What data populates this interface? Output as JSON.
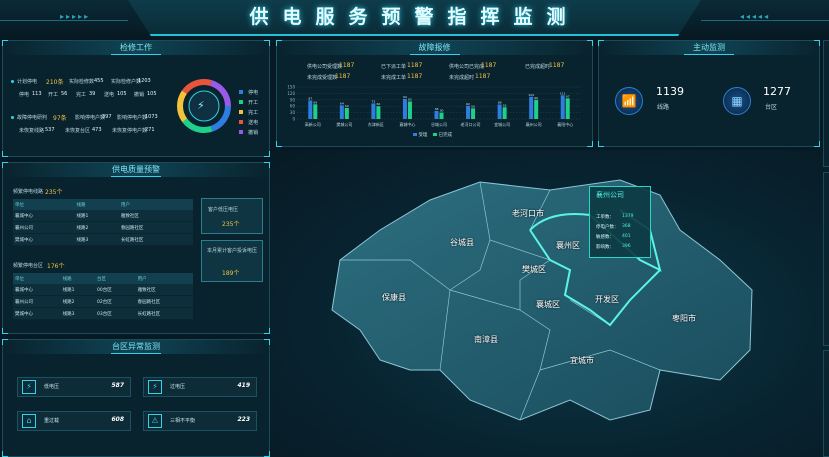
{
  "header": {
    "title": "供电服务预警指挥监测"
  },
  "repair": {
    "title": "检修工作",
    "planned": {
      "label": "计划停电",
      "count": "210条",
      "items": [
        {
          "label": "实际检修数",
          "value": "455"
        },
        {
          "label": "实际检修户数",
          "value": "1203"
        },
        {
          "label": "停电",
          "value": "113"
        },
        {
          "label": "开工",
          "value": "56"
        },
        {
          "label": "完工",
          "value": "39"
        },
        {
          "label": "送电",
          "value": "105"
        },
        {
          "label": "撤销",
          "value": "105"
        }
      ]
    },
    "fault": {
      "label": "故障停电研判",
      "count": "97条",
      "items": [
        {
          "label": "影响停电户数",
          "value": "397"
        },
        {
          "label": "影响停电户数",
          "value": "1073"
        },
        {
          "label": "未恢复线路",
          "value": "537"
        },
        {
          "label": "未恢复台区",
          "value": "473"
        },
        {
          "label": "未恢复停电户数",
          "value": "271"
        }
      ]
    },
    "legend": [
      "停电",
      "开工",
      "完工",
      "送电",
      "撤销"
    ],
    "ring_icon": "lightning-icon"
  },
  "quality": {
    "title": "供电质量预警",
    "low_voltage": {
      "label": "频繁停电线路",
      "count": "235个",
      "headers": [
        "单位",
        "线路",
        "用户"
      ],
      "rows": [
        [
          "襄城中心",
          "线路1",
          "雅致社区"
        ],
        [
          "襄州公司",
          "线路2",
          "春园路社区"
        ],
        [
          "樊城中心",
          "线路3",
          "长虹路社区"
        ]
      ]
    },
    "frequent": {
      "label": "频繁停电台区",
      "count": "176个",
      "headers": [
        "单位",
        "线路",
        "台区",
        "用户"
      ],
      "rows": [
        [
          "襄城中心",
          "线路1",
          "00台区",
          "雅致社区"
        ],
        [
          "襄州公司",
          "线路2",
          "02台区",
          "春园路社区"
        ],
        [
          "樊城中心",
          "线路3",
          "03台区",
          "长虹路社区"
        ]
      ]
    },
    "side_cards": [
      {
        "label": "客户低压电压",
        "value": "235个"
      },
      {
        "label": "本月累计客户投诉电压",
        "value": "189个"
      }
    ]
  },
  "station": {
    "title": "台区异常监测",
    "items": [
      {
        "icon": "voltage-low-icon",
        "glyph": "⚡",
        "label": "低电压",
        "value": "587"
      },
      {
        "icon": "voltage-high-icon",
        "glyph": "⚡",
        "label": "过电压",
        "value": "419"
      },
      {
        "icon": "overload-icon",
        "glyph": "⌂",
        "label": "重过载",
        "value": "608"
      },
      {
        "icon": "phase-imbalance-icon",
        "glyph": "⚠",
        "label": "三相不平衡",
        "value": "223"
      }
    ]
  },
  "fault_repair": {
    "title": "故障报修",
    "stats": [
      {
        "label": "供电公司受理数",
        "value": "1187"
      },
      {
        "label": "已下派工单",
        "value": "1187"
      },
      {
        "label": "供电公司已完成",
        "value": "1187"
      },
      {
        "label": "已完成超时",
        "value": "1187"
      },
      {
        "label": "未完成受理数",
        "value": "1187"
      },
      {
        "label": "未完成工单",
        "value": "1187"
      },
      {
        "label": "未完成超时",
        "value": "1187"
      }
    ],
    "legend": [
      "受理",
      "已完成"
    ],
    "colors": {
      "s1": "#2e7de0",
      "s2": "#1fd08a"
    }
  },
  "chart_data": {
    "type": "bar",
    "categories": [
      "高新公司",
      "樊城公司",
      "东津新区",
      "襄城中心",
      "谷城公司",
      "老河口公司",
      "宜城公司",
      "襄州公司",
      "襄阳中心"
    ],
    "series": [
      {
        "name": "受理",
        "values": [
          87,
          64,
          73,
          94,
          38,
          62,
          68,
          104,
          111
        ]
      },
      {
        "name": "已完成",
        "values": [
          69,
          52,
          60,
          82,
          30,
          50,
          55,
          90,
          97
        ]
      }
    ],
    "ylim": [
      0,
      150
    ],
    "yticks": [
      "150",
      "120",
      "90",
      "60",
      "30",
      "0"
    ],
    "grid": true,
    "legend": "bottom"
  },
  "monitor": {
    "title": "主动监测",
    "items": [
      {
        "icon": "signal-tower-icon",
        "glyph": "📶",
        "value": "1139",
        "label": "线路"
      },
      {
        "icon": "building-icon",
        "glyph": "▦",
        "value": "1277",
        "label": "台区"
      }
    ]
  },
  "map": {
    "regions": [
      "老河口市",
      "谷城县",
      "襄州区",
      "樊城区",
      "保康县",
      "襄城区",
      "开发区",
      "枣阳市",
      "南漳县",
      "宜城市"
    ],
    "popup": {
      "title": "襄州公司",
      "rows": [
        {
          "label": "工单数：",
          "value": "1379"
        },
        {
          "label": "停电户数：",
          "value": "368"
        },
        {
          "label": "敏感数：",
          "value": "401"
        },
        {
          "label": "影响数：",
          "value": "396"
        }
      ]
    }
  }
}
